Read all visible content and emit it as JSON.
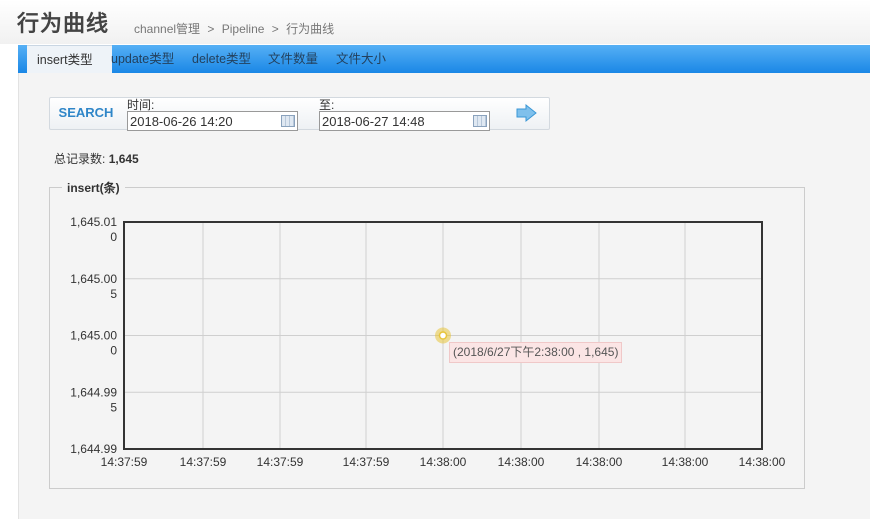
{
  "header": {
    "title": "行为曲线",
    "breadcrumb": [
      "channel管理",
      ">",
      "Pipeline",
      ">",
      "行为曲线"
    ]
  },
  "tabs": [
    {
      "label": "insert类型",
      "active": true
    },
    {
      "label": "update类型",
      "active": false
    },
    {
      "label": "delete类型",
      "active": false
    },
    {
      "label": "文件数量",
      "active": false
    },
    {
      "label": "文件大小",
      "active": false
    }
  ],
  "search": {
    "button_label": "SEARCH",
    "start_label": "时间:",
    "start_value": "2018-06-26 14:20",
    "end_label": "至:",
    "end_value": "2018-06-27 14:48",
    "go_icon": "arrow-right-icon"
  },
  "total": {
    "label": "总记录数:",
    "value": "1,645"
  },
  "chart_data": {
    "type": "line",
    "title": "insert(条)",
    "y_ticks": [
      [
        "1,645.01",
        "0"
      ],
      [
        "1,645.00",
        "5"
      ],
      [
        "1,645.00",
        "0"
      ],
      [
        "1,644.99",
        "5"
      ],
      [
        "1,644.99",
        ""
      ]
    ],
    "x_ticks": [
      "14:37:59",
      "14:37:59",
      "14:37:59",
      "14:37:59",
      "14:38:00",
      "14:38:00",
      "14:38:00",
      "14:38:00",
      "14:38:00"
    ],
    "ylim": [
      1644.99,
      1645.01
    ],
    "grid": true,
    "series": [
      {
        "points": [
          {
            "x": "2018/6/27 14:38:00",
            "y": 1645
          }
        ],
        "color": "#e8c53a"
      }
    ],
    "tooltip": "(2018/6/27下午2:38:00 , 1,645)"
  }
}
